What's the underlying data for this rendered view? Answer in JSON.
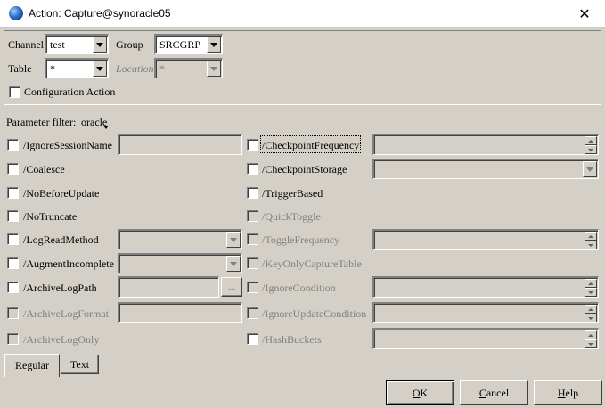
{
  "window": {
    "title": "Action: Capture@synoracle05",
    "close_glyph": "✕"
  },
  "scope": {
    "channel_label": "Channel",
    "channel_value": "test",
    "group_label": "Group",
    "group_value": "SRCGRP",
    "table_label": "Table",
    "table_value": "*",
    "location_label": "Location",
    "location_value": "*",
    "config_action_label": "Configuration Action"
  },
  "filter": {
    "label": "Parameter filter:",
    "value": "oracle"
  },
  "left_params": [
    {
      "label": "/IgnoreSessionName"
    },
    {
      "label": "/Coalesce"
    },
    {
      "label": "/NoBeforeUpdate"
    },
    {
      "label": "/NoTruncate"
    },
    {
      "label": "/LogReadMethod"
    },
    {
      "label": "/AugmentIncomplete"
    },
    {
      "label": "/ArchiveLogPath",
      "browse": "..."
    },
    {
      "label": "/ArchiveLogFormat"
    },
    {
      "label": "/ArchiveLogOnly"
    }
  ],
  "right_params": [
    {
      "label": "/CheckpointFrequency"
    },
    {
      "label": "/CheckpointStorage"
    },
    {
      "label": "/TriggerBased"
    },
    {
      "label": "/QuickToggle"
    },
    {
      "label": "/ToggleFrequency"
    },
    {
      "label": "/KeyOnlyCaptureTable"
    },
    {
      "label": "/IgnoreCondition"
    },
    {
      "label": "/IgnoreUpdateCondition"
    },
    {
      "label": "/HashBuckets"
    }
  ],
  "tabs": {
    "regular": "Regular",
    "text": "Text"
  },
  "buttons": {
    "ok_mnemonic": "O",
    "ok_rest": "K",
    "cancel_mnemonic": "C",
    "cancel_rest": "ancel",
    "help_mnemonic": "H",
    "help_rest": "elp"
  },
  "colors": {
    "dialog_bg": "#d4d0c8",
    "disabled_text": "#808080"
  }
}
